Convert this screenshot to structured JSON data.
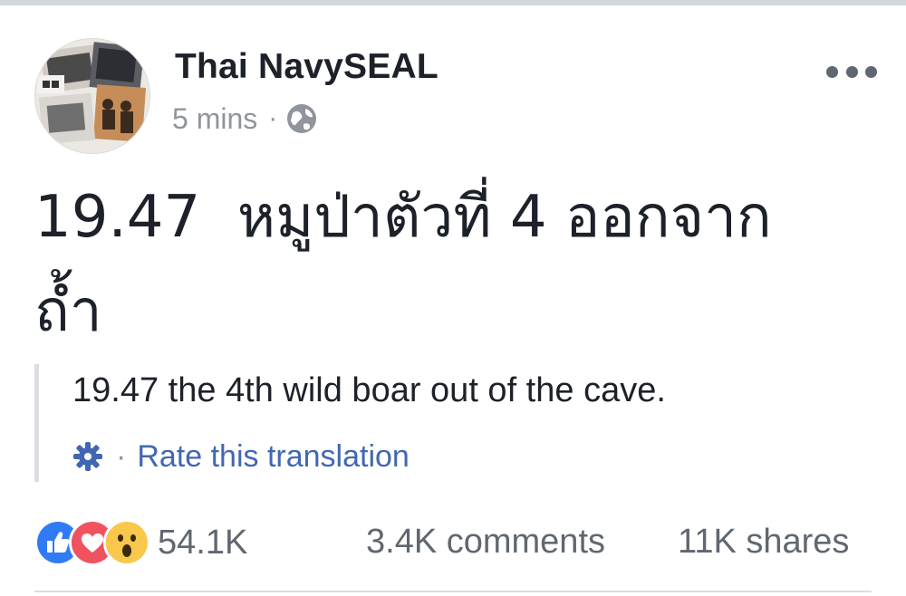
{
  "post": {
    "author": "Thai NavySEAL",
    "time": "5 mins",
    "separator": "·",
    "privacy_icon": "globe-icon",
    "more_icon": "more-options-icon",
    "text_line1": "19.47  หมูป่าตัวที่ 4 ออกจาก",
    "text_line2": "ถ้ำ"
  },
  "translation": {
    "text": "19.47 the 4th wild boar out of the cave.",
    "settings_icon": "gear-icon",
    "separator": "·",
    "rate_label": "Rate this translation"
  },
  "engagement": {
    "reaction_icons": [
      "like-icon",
      "love-icon",
      "wow-icon"
    ],
    "reaction_count": "54.1K",
    "comments": "3.4K comments",
    "shares": "11K shares"
  },
  "colors": {
    "link": "#4267b2",
    "secondary_text": "#90949c",
    "like": "#2f7bf6",
    "love": "#f0525f",
    "wow": "#f7c84b"
  }
}
